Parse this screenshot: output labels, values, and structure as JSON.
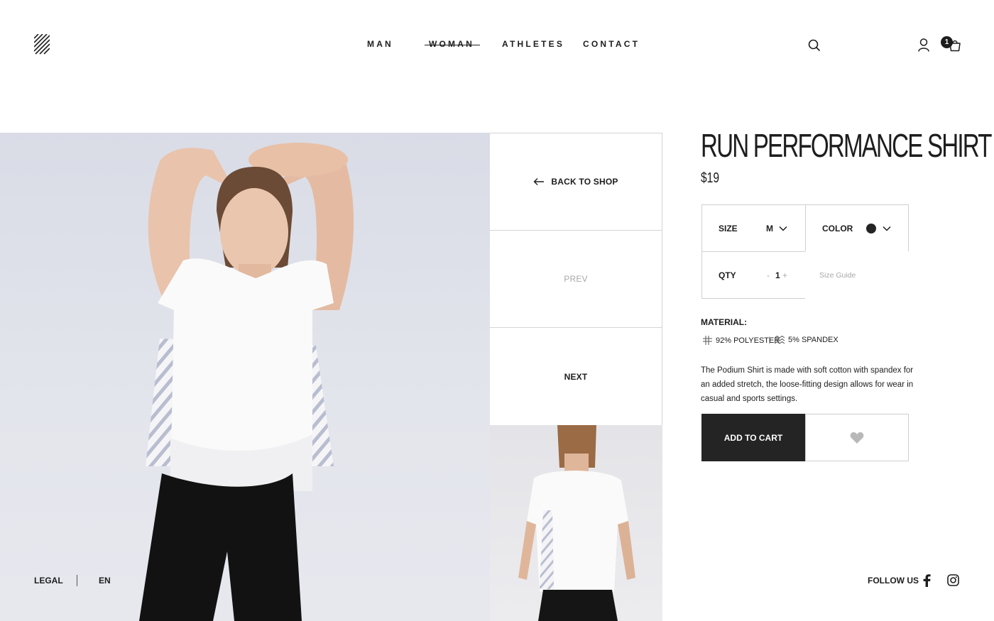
{
  "header": {
    "nav": [
      {
        "label": "MAN",
        "active": false
      },
      {
        "label": "WOMAN",
        "active": true
      },
      {
        "label": "ATHLETES",
        "active": false
      },
      {
        "label": "CONTACT",
        "active": false
      }
    ],
    "cart_count": "1",
    "icons": [
      "logo",
      "search-icon",
      "user-icon",
      "cart-icon"
    ]
  },
  "panel": {
    "back_label": "BACK TO SHOP",
    "prev_label": "PREV",
    "next_label": "NEXT"
  },
  "product": {
    "title": "RUN PERFORMANCE SHIRT",
    "price": "$19",
    "size_label": "SIZE",
    "size_value": "M",
    "color_label": "COLOR",
    "color_value": "#242424",
    "qty_label": "QTY",
    "qty_minus": "-",
    "qty_value": "1",
    "qty_plus": "+",
    "size_guide": "Size Guide",
    "material_label": "MATERIAL:",
    "materials": [
      "92% POLYESTER",
      "5% SPANDEX"
    ],
    "description": "The Podium Shirt is made with soft cotton with spandex for an added stretch, the loose-fitting design allows for wear in casual and sports settings.",
    "add_to_cart": "ADD TO CART"
  },
  "footer": {
    "legal": "LEGAL",
    "language": "EN",
    "follow": "FOLLOW US"
  },
  "colors": {
    "text": "#1d1d1d",
    "button_dark": "#242424",
    "border": "#cfcfcf",
    "muted": "#a8a8a8"
  }
}
